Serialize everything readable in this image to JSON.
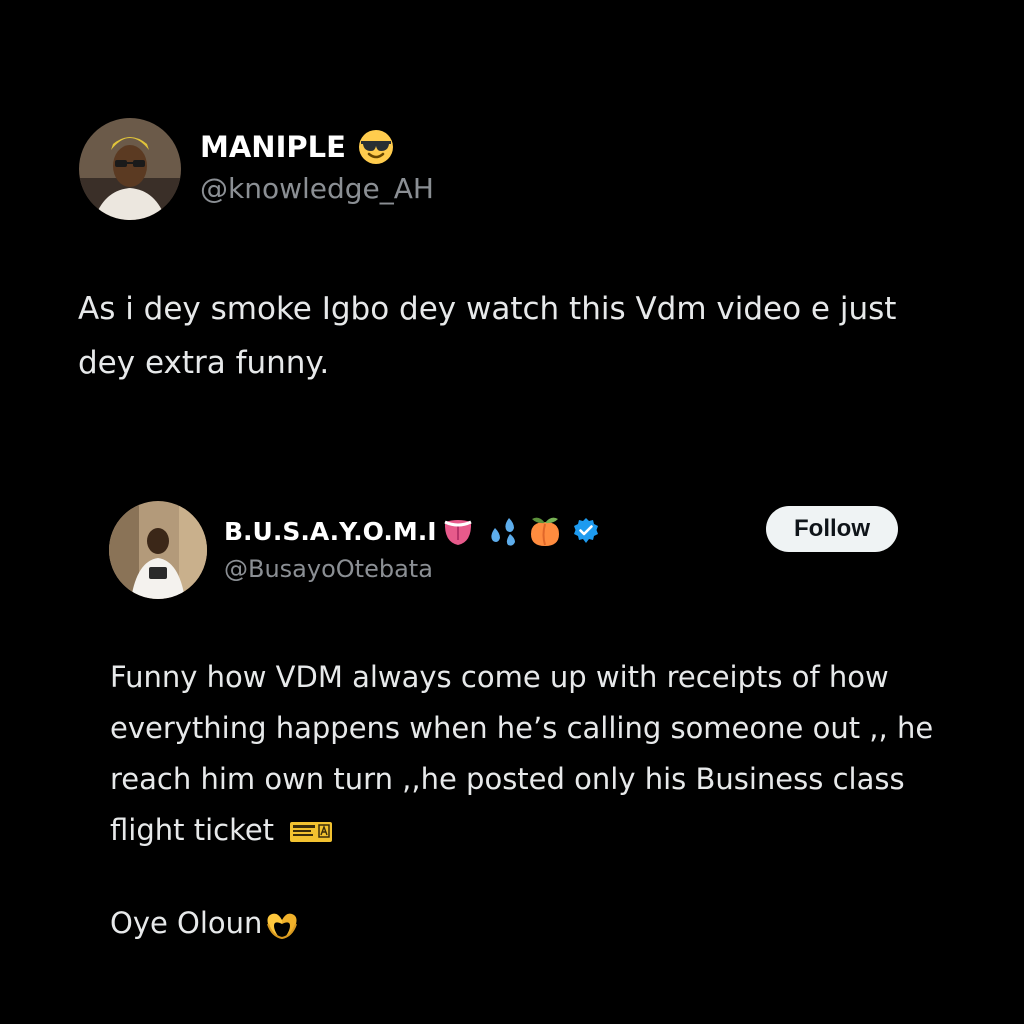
{
  "main_tweet": {
    "display_name": "MANIPLE",
    "name_emoji": "smiling-face-with-sunglasses-emoji",
    "handle": "@knowledge_AH",
    "text": "As i dey smoke Igbo dey watch this Vdm video e just dey extra funny."
  },
  "quoted_tweet": {
    "display_name": "B.U.S.A.Y.O.M.I",
    "name_emojis": [
      "tongue-emoji",
      "sweat-droplets-emoji",
      "peach-emoji"
    ],
    "verified_badge": "verified-badge-icon",
    "handle": "@BusayoOtebata",
    "follow_label": "Follow",
    "paragraphs": [
      "Funny how VDM always come up with receipts of how everything happens when he’s calling someone out ,, he reach him own turn ,,he posted only his Business class flight ticket",
      "Oye Oloun"
    ],
    "inline_emojis": [
      "ticket-emoji",
      "heart-hands-emoji"
    ]
  },
  "colors": {
    "background": "#000000",
    "text": "#e7e9ea",
    "handle": "#8b8f94",
    "verified": "#1d9bf0",
    "follow_bg": "#eff3f4"
  }
}
